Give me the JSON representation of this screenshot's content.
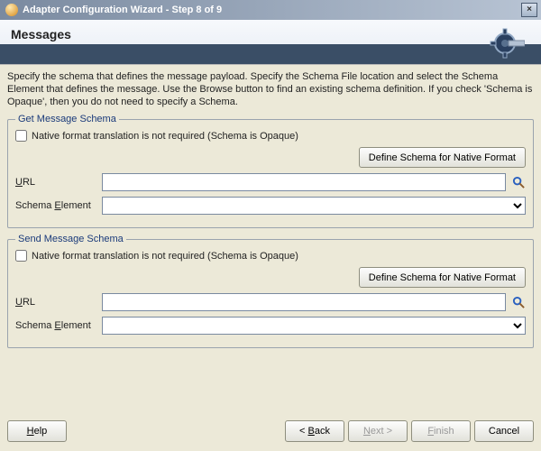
{
  "window": {
    "title": "Adapter Configuration Wizard - Step 8 of 9",
    "close_icon": "×"
  },
  "banner": {
    "title": "Messages"
  },
  "description": "Specify the schema that defines the message payload.  Specify the Schema File location and select the Schema Element that defines the message. Use the Browse button to find an existing schema definition. If you check 'Schema is Opaque', then you do not need to specify a Schema.",
  "get_schema": {
    "legend": "Get Message Schema",
    "opaque_label": "Native format translation is not required (Schema is Opaque)",
    "opaque_checked": false,
    "define_btn": "Define Schema for Native Format",
    "url_label_pre": "U",
    "url_label_post": "RL",
    "url_value": "",
    "element_label_pre": "Schema ",
    "element_label_ul": "E",
    "element_label_post": "lement",
    "element_value": ""
  },
  "send_schema": {
    "legend": "Send Message Schema",
    "opaque_label": "Native format translation is not required (Schema is Opaque)",
    "opaque_checked": false,
    "define_btn": "Define Schema for Native Format",
    "url_label_pre": "U",
    "url_label_post": "RL",
    "url_value": "",
    "element_label_pre": "Schema ",
    "element_label_ul": "E",
    "element_label_post": "lement",
    "element_value": ""
  },
  "footer": {
    "help": "Help",
    "back": "< Back",
    "next": "Next >",
    "finish": "Finish",
    "cancel": "Cancel",
    "next_enabled": false,
    "finish_enabled": false
  }
}
